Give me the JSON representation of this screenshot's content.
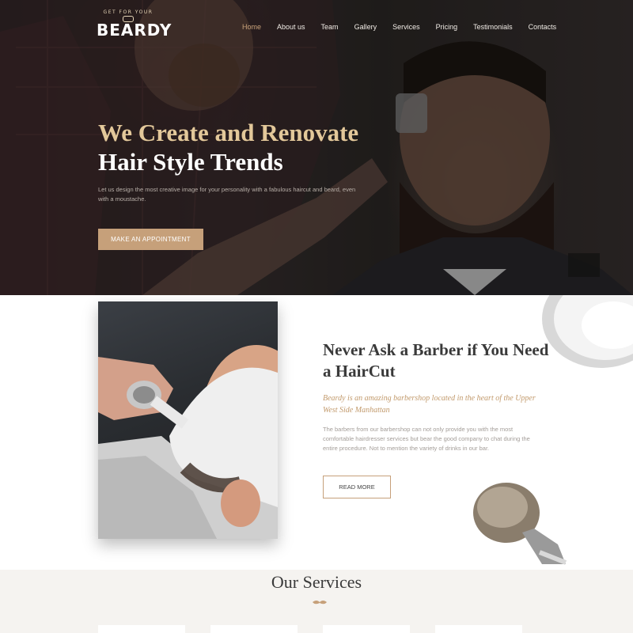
{
  "header": {
    "logo": {
      "tagline": "GET FOR YOUR",
      "wordmark": "BEARDY"
    },
    "nav": [
      "Home",
      "About us",
      "Team",
      "Gallery",
      "Services",
      "Pricing",
      "Testimonials",
      "Contacts"
    ],
    "active_nav": "Home"
  },
  "hero": {
    "title_line1": "We Create and Renovate",
    "title_line2": "Hair Style Trends",
    "description": "Let us design the most creative image for your personality with a fabulous haircut and beard, even with a moustache.",
    "cta_label": "MAKE AN APPOINTMENT"
  },
  "about": {
    "title": "Never Ask a Barber if You Need a HairCut",
    "lead": "Beardy is an amazing barbershop located in the heart of the Upper West Side Manhattan",
    "body": "The barbers from our barbershop can not only provide you with the most comfortable hairdresser services but bear the good company to chat during the entire procedure. Not to mention the variety of drinks in our bar.",
    "button_label": "READ MORE"
  },
  "services": {
    "title": "Our Services"
  },
  "colors": {
    "accent": "#c6a07a",
    "accent_text": "#c29a6c",
    "heading": "#3a3a3a",
    "hero_title_gold": "#e3c89a"
  }
}
